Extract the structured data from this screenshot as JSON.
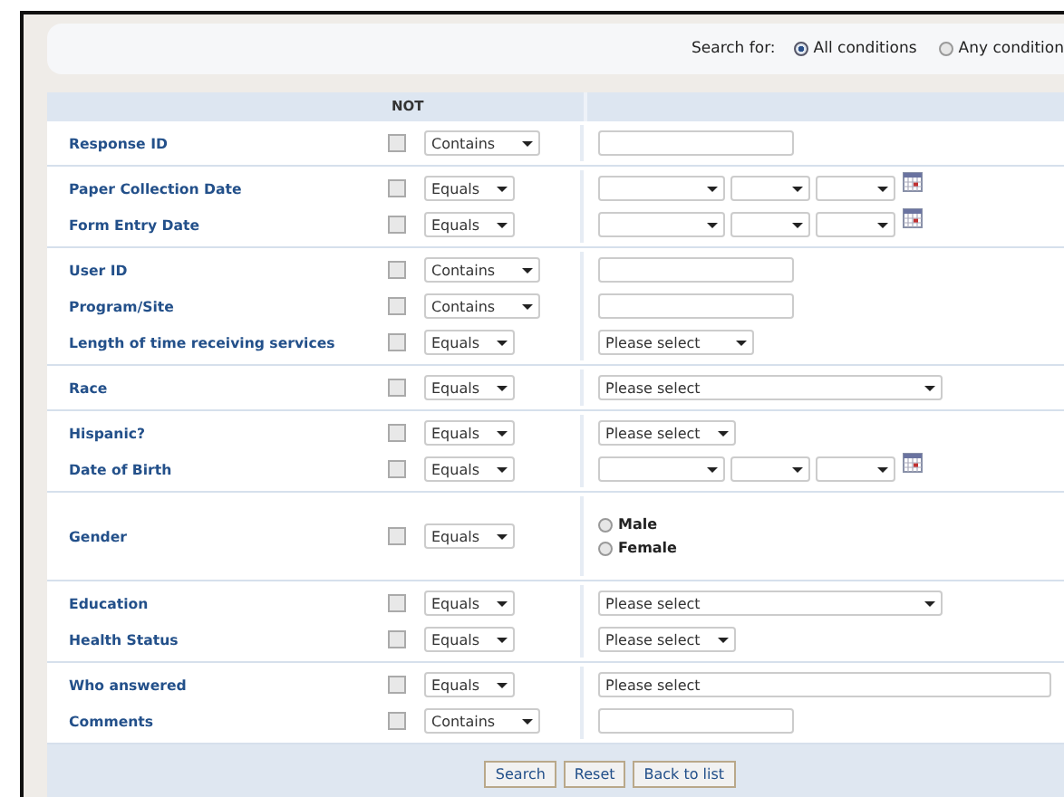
{
  "search_for": {
    "label": "Search for:",
    "options": [
      {
        "label": "All conditions",
        "selected": true
      },
      {
        "label": "Any condition",
        "selected": false
      }
    ]
  },
  "table": {
    "header": "NOT",
    "groups": [
      {
        "rows": [
          {
            "label": "Response ID",
            "not": false,
            "operator": "Contains",
            "kind": "text"
          }
        ]
      },
      {
        "rows": [
          {
            "label": "Paper Collection Date",
            "not": false,
            "operator": "Equals",
            "kind": "date"
          },
          {
            "label": "Form Entry Date",
            "not": false,
            "operator": "Equals",
            "kind": "date"
          }
        ]
      },
      {
        "rows": [
          {
            "label": "User ID",
            "not": false,
            "operator": "Contains",
            "kind": "text"
          },
          {
            "label": "Program/Site",
            "not": false,
            "operator": "Contains",
            "kind": "text"
          },
          {
            "label": "Length of time receiving services",
            "not": false,
            "operator": "Equals",
            "kind": "select",
            "value": "Please select"
          }
        ]
      },
      {
        "rows": [
          {
            "label": "Race",
            "not": false,
            "operator": "Equals",
            "kind": "longselect",
            "value": "Please select"
          }
        ]
      },
      {
        "rows": [
          {
            "label": "Hispanic?",
            "not": false,
            "operator": "Equals",
            "kind": "shortselect",
            "value": "Please select"
          },
          {
            "label": "Date of Birth",
            "not": false,
            "operator": "Equals",
            "kind": "date"
          }
        ]
      },
      {
        "rows": [
          {
            "label": "Gender",
            "not": false,
            "operator": "Equals",
            "kind": "radio",
            "options": [
              {
                "label": "Male",
                "selected": false
              },
              {
                "label": "Female",
                "selected": false
              }
            ]
          }
        ]
      },
      {
        "rows": [
          {
            "label": "Education",
            "not": false,
            "operator": "Equals",
            "kind": "longselect",
            "value": "Please select"
          },
          {
            "label": "Health Status",
            "not": false,
            "operator": "Equals",
            "kind": "shortselect",
            "value": "Please select"
          }
        ]
      },
      {
        "rows": [
          {
            "label": "Who answered",
            "not": false,
            "operator": "Equals",
            "kind": "textvalue",
            "value": "Please select"
          },
          {
            "label": "Comments",
            "not": false,
            "operator": "Contains",
            "kind": "text"
          }
        ]
      }
    ]
  },
  "buttons": [
    "Search",
    "Reset",
    "Back to list"
  ]
}
